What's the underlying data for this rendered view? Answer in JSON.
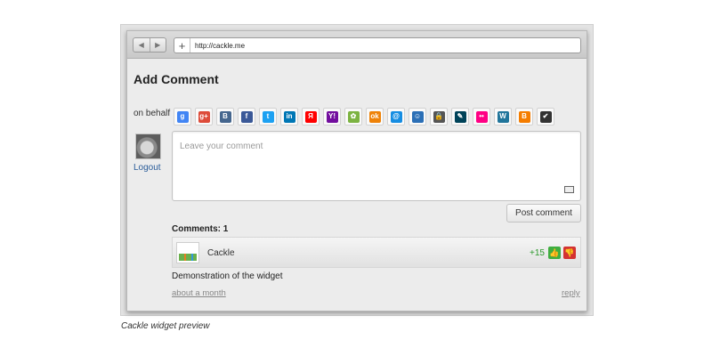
{
  "browser": {
    "back_glyph": "◀",
    "forward_glyph": "▶",
    "new_tab_glyph": "+",
    "url": "http://cackle.me"
  },
  "widget": {
    "title": "Add Comment",
    "on_behalf_label": "on behalf",
    "providers": [
      {
        "name": "google-icon",
        "glyph": "g",
        "color": "#4285f4"
      },
      {
        "name": "google-plus-icon",
        "glyph": "g+",
        "color": "#dd4b39"
      },
      {
        "name": "vkontakte-icon",
        "glyph": "B",
        "color": "#45668e"
      },
      {
        "name": "facebook-icon",
        "glyph": "f",
        "color": "#3b5998"
      },
      {
        "name": "twitter-icon",
        "glyph": "t",
        "color": "#1da1f2"
      },
      {
        "name": "linkedin-icon",
        "glyph": "in",
        "color": "#0077b5"
      },
      {
        "name": "yandex-icon",
        "glyph": "Я",
        "color": "#ff0000"
      },
      {
        "name": "yahoo-icon",
        "glyph": "Y!",
        "color": "#720e9e"
      },
      {
        "name": "myworld-icon",
        "glyph": "✿",
        "color": "#7cb342"
      },
      {
        "name": "odnoklassniki-icon",
        "glyph": "ok",
        "color": "#ee8208"
      },
      {
        "name": "mailru-icon",
        "glyph": "@",
        "color": "#168de2"
      },
      {
        "name": "rambler-icon",
        "glyph": "☺",
        "color": "#2b6fb6"
      },
      {
        "name": "openid-lock-icon",
        "glyph": "🔒",
        "color": "#555555"
      },
      {
        "name": "livejournal-icon",
        "glyph": "✎",
        "color": "#004359"
      },
      {
        "name": "flickr-icon",
        "glyph": "••",
        "color": "#ff0084"
      },
      {
        "name": "wordpress-icon",
        "glyph": "W",
        "color": "#21759b"
      },
      {
        "name": "blogger-icon",
        "glyph": "B",
        "color": "#f57d00"
      },
      {
        "name": "checkmark-icon",
        "glyph": "✔",
        "color": "#333333"
      }
    ],
    "logout_label": "Logout",
    "comment_placeholder": "Leave your comment",
    "post_button_label": "Post comment",
    "comments_count_label": "Comments: 1",
    "comment": {
      "author": "Cackle",
      "score": "+15",
      "text": "Demonstration of the widget",
      "time": "about a month",
      "reply_label": "reply",
      "upvote_glyph": "👍",
      "downvote_glyph": "👎"
    }
  },
  "caption": "Cackle widget preview"
}
